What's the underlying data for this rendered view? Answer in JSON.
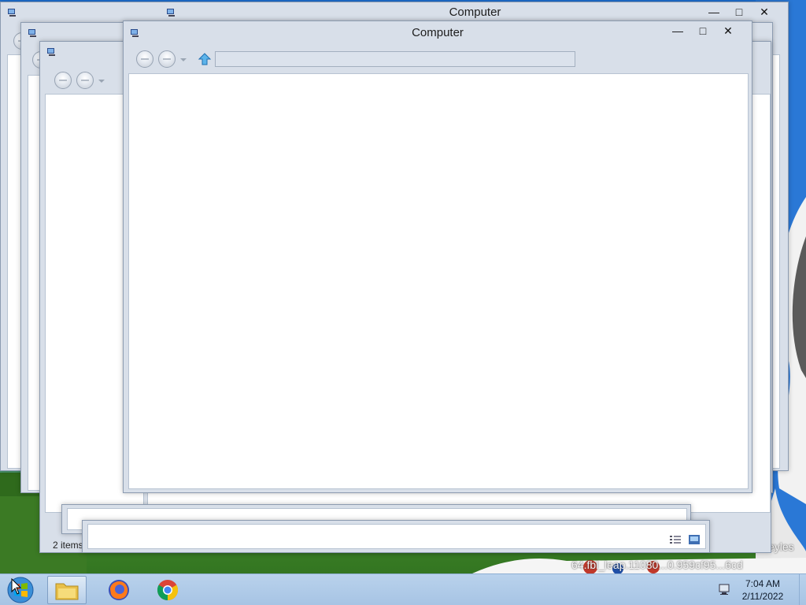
{
  "desktop": {
    "wallpaper_text_1": "eyles",
    "wallpaper_text_2": "64.fbl_leap.11080...0.959cf95...6cd"
  },
  "windows": {
    "back_window_1": {
      "title": "Computer"
    },
    "back_window_2": {
      "title": ""
    },
    "back_window_3": {
      "title": "",
      "status_items": "2 items"
    },
    "front_window": {
      "title": "Computer",
      "address_value": "",
      "minimize_glyph": "—",
      "maximize_glyph": "□",
      "close_glyph": "✕"
    }
  },
  "taskbar": {
    "apps": [
      "Start",
      "Windows Explorer",
      "Firefox",
      "Google Chrome"
    ],
    "clock_time": "7:04 AM",
    "clock_date": "2/11/2022"
  },
  "colors": {
    "window_frame": "#d8dfe9",
    "taskbar": "#b1cbe8",
    "content_bg": "#ffffff"
  }
}
